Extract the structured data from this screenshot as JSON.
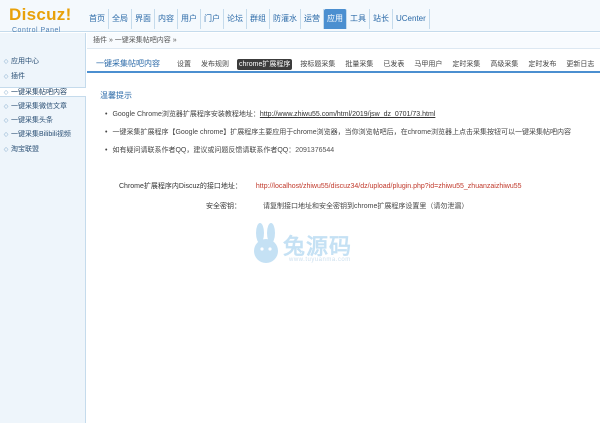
{
  "header": {
    "logo": "Discuz!",
    "logo_sub": "Control Panel"
  },
  "topnav": [
    {
      "label": "首页",
      "active": false
    },
    {
      "label": "全局",
      "active": false
    },
    {
      "label": "界面",
      "active": false
    },
    {
      "label": "内容",
      "active": false
    },
    {
      "label": "用户",
      "active": false
    },
    {
      "label": "门户",
      "active": false
    },
    {
      "label": "论坛",
      "active": false
    },
    {
      "label": "群组",
      "active": false
    },
    {
      "label": "防灌水",
      "active": false
    },
    {
      "label": "运营",
      "active": false
    },
    {
      "label": "应用",
      "active": true
    },
    {
      "label": "工具",
      "active": false
    },
    {
      "label": "站长",
      "active": false
    },
    {
      "label": "UCenter",
      "active": false
    }
  ],
  "sidebar": {
    "items": [
      {
        "label": "应用中心",
        "active": false
      },
      {
        "label": "插件",
        "active": false
      },
      {
        "label": "一键采集帖吧内容",
        "active": true
      },
      {
        "label": "一键采集微信文章",
        "active": false
      },
      {
        "label": "一键采集头条",
        "active": false
      },
      {
        "label": "一键采集Bilibili视频",
        "active": false
      },
      {
        "label": "淘宝联盟",
        "active": false
      }
    ]
  },
  "breadcrumb": "插件 » 一键采集帖吧内容 »",
  "plugin_title": "一键采集帖吧内容",
  "subtabs": [
    {
      "label": "设置",
      "active": false
    },
    {
      "label": "发布规则",
      "active": false
    },
    {
      "label": "chrome扩展程序",
      "active": true
    },
    {
      "label": "按标题采集",
      "active": false
    },
    {
      "label": "批量采集",
      "active": false
    },
    {
      "label": "已发表",
      "active": false
    },
    {
      "label": "马甲用户",
      "active": false
    },
    {
      "label": "定时采集",
      "active": false
    },
    {
      "label": "高级采集",
      "active": false
    },
    {
      "label": "定时发布",
      "active": false
    },
    {
      "label": "更新日志",
      "active": false
    }
  ],
  "tips": {
    "title": "温馨提示",
    "items": [
      {
        "text": "Google Chrome浏览器扩展程序安装教程地址：",
        "link": "http://www.zhiwu55.com/html/2019/jsw_dz_0701/73.html"
      },
      {
        "text": "一键采集扩展程序【Google chrome】扩展程序主要应用于chrome浏览器，当你浏览帖吧后，在chrome浏览器上点击采集按钮可以一键采集帖吧内容",
        "link": ""
      },
      {
        "text": "如有疑问请联系作者QQ，建议或问题反馈请联系作者QQ：",
        "link": "2091376544"
      }
    ]
  },
  "form": {
    "row1_label": "Chrome扩展程序内Discuz的接口地址：",
    "row1_value": "http://localhost/zhiwu55/discuz34/dz/upload/plugin.php?id=zhiwu55_zhuanzaizhiwu55",
    "row2_label": "安全密钥：",
    "row2_value": "请复制接口地址和安全密钥到chrome扩展程序设置里（请勿泄漏）"
  },
  "watermark": {
    "text": "兔源码",
    "url": "www.tuyuanma.com"
  }
}
